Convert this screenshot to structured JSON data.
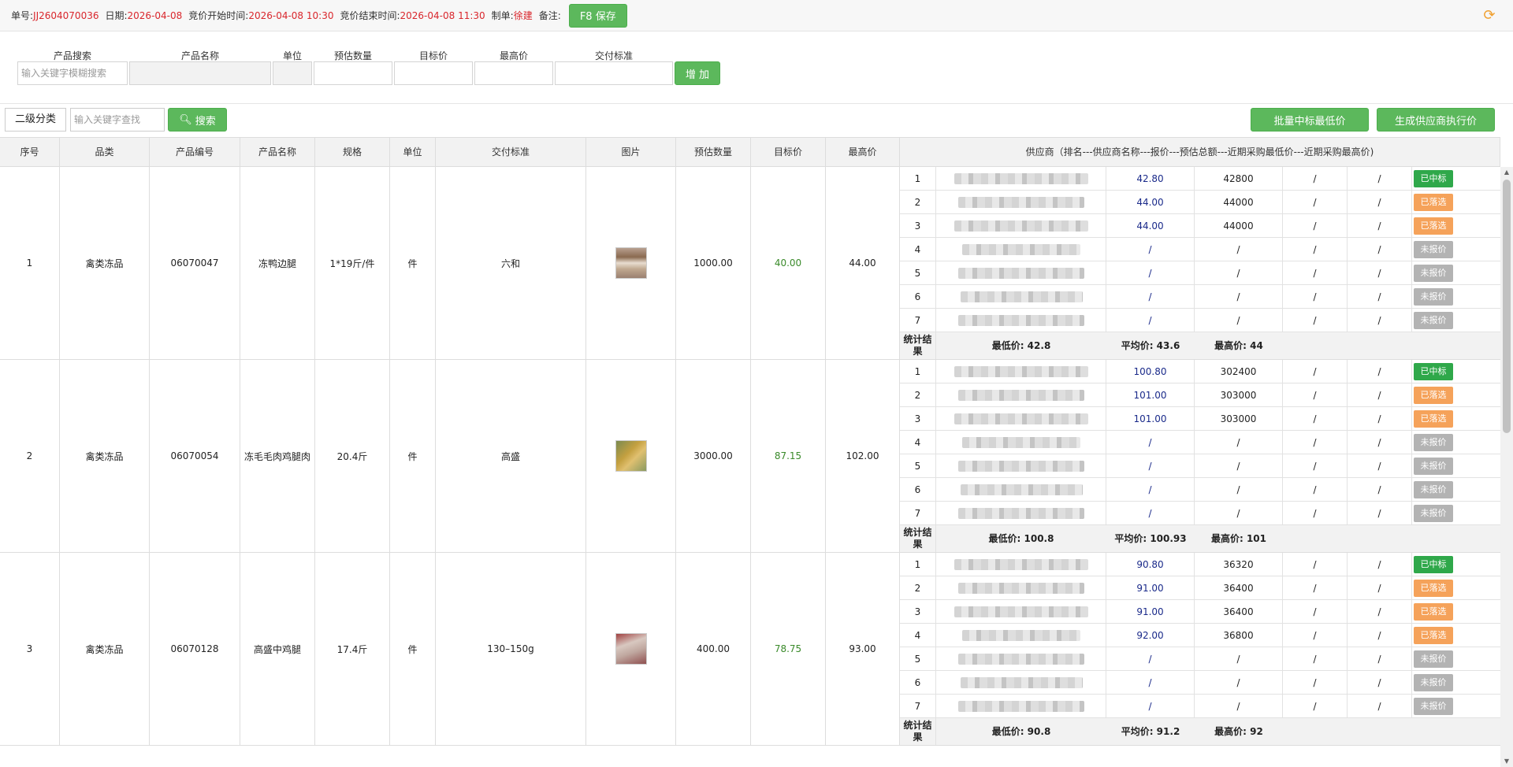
{
  "header": {
    "order_label": "单号:",
    "order_no": "JJ2604070036",
    "date_label": "日期:",
    "date": "2026-04-08",
    "start_label": "竞价开始时间:",
    "start": "2026-04-08 10:30",
    "end_label": "竞价结束时间:",
    "end": "2026-04-08 11:30",
    "maker_label": "制单:",
    "maker": "徐建",
    "note_label": "备注:",
    "save_label": "F8 保存",
    "refresh_icon": "refresh-icon"
  },
  "addform": {
    "labels": [
      "产品搜索",
      "产品名称",
      "单位",
      "预估数量",
      "目标价",
      "最高价",
      "交付标准"
    ],
    "search_placeholder": "输入关键字模糊搜索",
    "add_label": "增 加"
  },
  "filter": {
    "category_label": "二级分类",
    "keyword_placeholder": "输入关键字查找",
    "search_label": "搜索",
    "batch_label": "批量中标最低价",
    "generate_label": "生成供应商执行价"
  },
  "table": {
    "headers": [
      "序号",
      "品类",
      "产品编号",
      "产品名称",
      "规格",
      "单位",
      "交付标准",
      "图片",
      "预估数量",
      "目标价",
      "最高价",
      "供应商（排名---供应商名称---报价---预估总额---近期采购最低价---近期采购最高价)"
    ],
    "stat_label": "统计结果",
    "rows": [
      {
        "seq": "1",
        "category": "禽类冻品",
        "code": "06070047",
        "name": "冻鸭边腿",
        "spec": "1*19斤/件",
        "unit": "件",
        "standard": "六和",
        "qty": "1000.00",
        "target": "40.00",
        "max": "44.00",
        "suppliers": [
          {
            "rank": "1",
            "price": "42.80",
            "total": "42800",
            "low": "/",
            "high": "/",
            "status": "已中标",
            "kind": "win"
          },
          {
            "rank": "2",
            "price": "44.00",
            "total": "44000",
            "low": "/",
            "high": "/",
            "status": "已落选",
            "kind": "lose"
          },
          {
            "rank": "3",
            "price": "44.00",
            "total": "44000",
            "low": "/",
            "high": "/",
            "status": "已落选",
            "kind": "lose"
          },
          {
            "rank": "4",
            "price": "/",
            "total": "/",
            "low": "/",
            "high": "/",
            "status": "未报价",
            "kind": "none"
          },
          {
            "rank": "5",
            "price": "/",
            "total": "/",
            "low": "/",
            "high": "/",
            "status": "未报价",
            "kind": "none"
          },
          {
            "rank": "6",
            "price": "/",
            "total": "/",
            "low": "/",
            "high": "/",
            "status": "未报价",
            "kind": "none"
          },
          {
            "rank": "7",
            "price": "/",
            "total": "/",
            "low": "/",
            "high": "/",
            "status": "未报价",
            "kind": "none"
          }
        ],
        "stat_min": "最低价: 42.8",
        "stat_avg": "平均价: 43.6",
        "stat_max": "最高价: 44"
      },
      {
        "seq": "2",
        "category": "禽类冻品",
        "code": "06070054",
        "name": "冻毛毛肉鸡腿肉",
        "spec": "20.4斤",
        "unit": "件",
        "standard": "高盛",
        "qty": "3000.00",
        "target": "87.15",
        "max": "102.00",
        "suppliers": [
          {
            "rank": "1",
            "price": "100.80",
            "total": "302400",
            "low": "/",
            "high": "/",
            "status": "已中标",
            "kind": "win"
          },
          {
            "rank": "2",
            "price": "101.00",
            "total": "303000",
            "low": "/",
            "high": "/",
            "status": "已落选",
            "kind": "lose"
          },
          {
            "rank": "3",
            "price": "101.00",
            "total": "303000",
            "low": "/",
            "high": "/",
            "status": "已落选",
            "kind": "lose"
          },
          {
            "rank": "4",
            "price": "/",
            "total": "/",
            "low": "/",
            "high": "/",
            "status": "未报价",
            "kind": "none"
          },
          {
            "rank": "5",
            "price": "/",
            "total": "/",
            "low": "/",
            "high": "/",
            "status": "未报价",
            "kind": "none"
          },
          {
            "rank": "6",
            "price": "/",
            "total": "/",
            "low": "/",
            "high": "/",
            "status": "未报价",
            "kind": "none"
          },
          {
            "rank": "7",
            "price": "/",
            "total": "/",
            "low": "/",
            "high": "/",
            "status": "未报价",
            "kind": "none"
          }
        ],
        "stat_min": "最低价: 100.8",
        "stat_avg": "平均价: 100.93",
        "stat_max": "最高价: 101"
      },
      {
        "seq": "3",
        "category": "禽类冻品",
        "code": "06070128",
        "name": "高盛中鸡腿",
        "spec": "17.4斤",
        "unit": "件",
        "standard": "130–150g",
        "qty": "400.00",
        "target": "78.75",
        "max": "93.00",
        "suppliers": [
          {
            "rank": "1",
            "price": "90.80",
            "total": "36320",
            "low": "/",
            "high": "/",
            "status": "已中标",
            "kind": "win"
          },
          {
            "rank": "2",
            "price": "91.00",
            "total": "36400",
            "low": "/",
            "high": "/",
            "status": "已落选",
            "kind": "lose"
          },
          {
            "rank": "3",
            "price": "91.00",
            "total": "36400",
            "low": "/",
            "high": "/",
            "status": "已落选",
            "kind": "lose"
          },
          {
            "rank": "4",
            "price": "92.00",
            "total": "36800",
            "low": "/",
            "high": "/",
            "status": "已落选",
            "kind": "lose"
          },
          {
            "rank": "5",
            "price": "/",
            "total": "/",
            "low": "/",
            "high": "/",
            "status": "未报价",
            "kind": "none"
          },
          {
            "rank": "6",
            "price": "/",
            "total": "/",
            "low": "/",
            "high": "/",
            "status": "未报价",
            "kind": "none"
          },
          {
            "rank": "7",
            "price": "/",
            "total": "/",
            "low": "/",
            "high": "/",
            "status": "未报价",
            "kind": "none"
          }
        ],
        "stat_min": "最低价: 90.8",
        "stat_avg": "平均价: 91.2",
        "stat_max": "最高价: 92"
      }
    ]
  }
}
